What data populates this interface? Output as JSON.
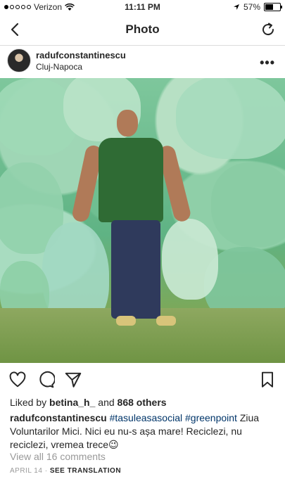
{
  "status_bar": {
    "carrier": "Verizon",
    "time": "11:11 PM",
    "battery": "57%",
    "battery_level": 0.57
  },
  "nav": {
    "title": "Photo",
    "back_icon": "chevron-left-icon",
    "refresh_icon": "refresh-icon"
  },
  "post": {
    "username": "radufconstantinescu",
    "location": "Cluj-Napoca",
    "more_label": "•••",
    "likes_prefix": "Liked by ",
    "liked_by": "betina_h_",
    "likes_mid": " and ",
    "likes_count": "868 others",
    "caption_user": "radufconstantinescu",
    "caption_tag1": "#tasuleasasocial",
    "caption_tag2": "#greenpoint",
    "caption_text": " Ziua Voluntarilor Mici. Nici eu nu-s așa mare! Reciclezi, nu reciclezi, vremea trece😉",
    "view_comments": "View all 16 comments",
    "date": "APRIL 14",
    "date_sep": " · ",
    "see_translation": "SEE TRANSLATION"
  }
}
